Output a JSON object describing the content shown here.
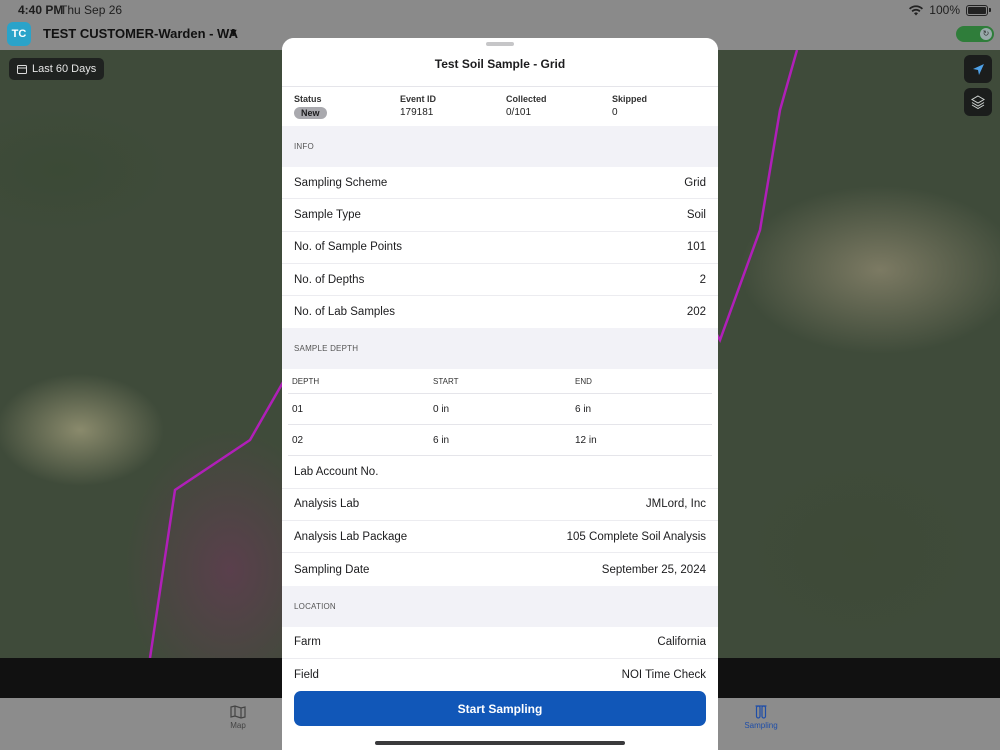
{
  "status_bar": {
    "time": "4:40 PM",
    "date": "Thu Sep 26",
    "battery": "100%"
  },
  "header": {
    "avatar_initials": "TC",
    "customer_name": "TEST CUSTOMER-Warden - WA"
  },
  "map": {
    "date_filter": "Last 60 Days",
    "boundary_color": "#b01fb8"
  },
  "tab_bar": {
    "map_label": "Map",
    "sampling_label": "Sampling"
  },
  "sheet": {
    "title": "Test Soil Sample - Grid",
    "summary": {
      "status_label": "Status",
      "status_value": "New",
      "event_id_label": "Event ID",
      "event_id_value": "179181",
      "collected_label": "Collected",
      "collected_value": "0/101",
      "skipped_label": "Skipped",
      "skipped_value": "0"
    },
    "info_header": "INFO",
    "info_rows": [
      {
        "label": "Sampling Scheme",
        "value": "Grid"
      },
      {
        "label": "Sample Type",
        "value": "Soil"
      },
      {
        "label": "No. of Sample Points",
        "value": "101"
      },
      {
        "label": "No. of Depths",
        "value": "2"
      },
      {
        "label": "No. of Lab Samples",
        "value": "202"
      }
    ],
    "depth_header": "SAMPLE DEPTH",
    "depth_columns": {
      "depth": "DEPTH",
      "start": "START",
      "end": "END"
    },
    "depth_rows": [
      {
        "depth": "01",
        "start": "0 in",
        "end": "6 in"
      },
      {
        "depth": "02",
        "start": "6 in",
        "end": "12 in"
      }
    ],
    "lab_rows": [
      {
        "label": "Lab Account No.",
        "value": ""
      },
      {
        "label": "Analysis Lab",
        "value": "JMLord, Inc"
      },
      {
        "label": "Analysis Lab Package",
        "value": "105 Complete Soil Analysis"
      },
      {
        "label": "Sampling Date",
        "value": "September 25, 2024"
      }
    ],
    "location_header": "LOCATION",
    "location_rows": [
      {
        "label": "Farm",
        "value": "California"
      },
      {
        "label": "Field",
        "value": "NOI Time Check"
      }
    ],
    "start_button": "Start Sampling"
  },
  "colors": {
    "accent": "#1157b8",
    "avatar": "#2aa3c9",
    "toggle_on": "#2f7d3a"
  }
}
